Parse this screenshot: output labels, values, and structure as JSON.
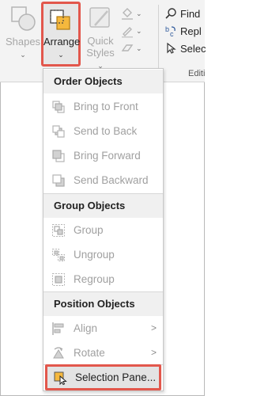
{
  "ribbon": {
    "shapes_label": "Shapes",
    "arrange_label": "Arrange",
    "quick_styles_line1": "Quick",
    "quick_styles_line2": "Styles",
    "editing": {
      "find_label": "Find",
      "replace_label": "Repl",
      "select_label": "Selec",
      "group_label": "Editi"
    }
  },
  "menu": {
    "sections": {
      "order": "Order Objects",
      "group": "Group Objects",
      "position": "Position Objects"
    },
    "items": {
      "bring_to_front": "Bring to Front",
      "send_to_back": "Send to Back",
      "bring_forward": "Bring Forward",
      "send_backward": "Send Backward",
      "group": "Group",
      "ungroup": "Ungroup",
      "regroup": "Regroup",
      "align": "Align",
      "rotate": "Rotate",
      "selection_pane": "Selection Pane..."
    }
  },
  "colors": {
    "highlight_border": "#e2574c",
    "arrange_icon_fill": "#f5b83d",
    "disabled_text": "#a0a0a0",
    "accent_blue": "#2b579a"
  }
}
